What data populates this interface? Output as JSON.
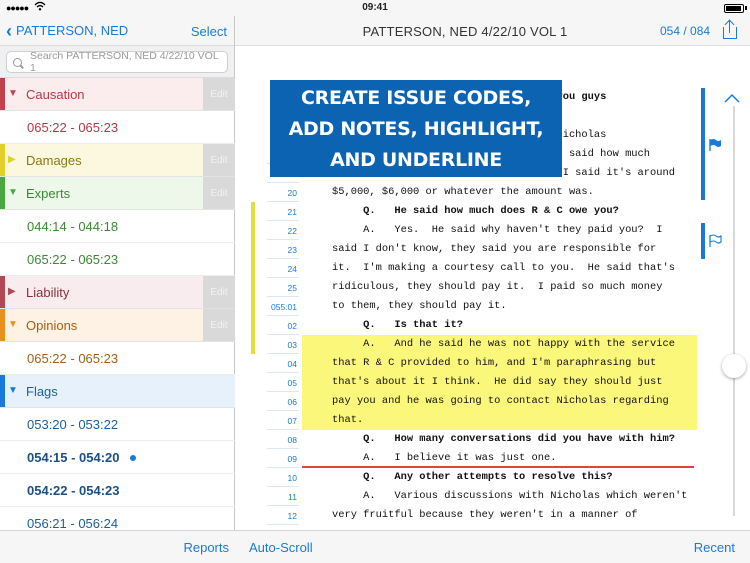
{
  "status": {
    "time": "09:41"
  },
  "left": {
    "back_label": "PATTERSON, NED",
    "select_label": "Select",
    "search_placeholder": "Search PATTERSON, NED 4/22/10 VOL 1",
    "rows": [
      {
        "kind": "category",
        "name": "Causation",
        "color": "#c0404b",
        "bg": "#fbecee",
        "edit": "Edit",
        "text_color": "#b03a45"
      },
      {
        "kind": "item",
        "text": "065:22 - 065:23",
        "color": "#b03a45"
      },
      {
        "kind": "category",
        "name": "Damages",
        "color": "#e2cf2a",
        "bg": "#fbf8df",
        "edit": "Edit",
        "text_color": "#8a7a12"
      },
      {
        "kind": "category",
        "name": "Experts",
        "color": "#4aa843",
        "bg": "#edf7ea",
        "edit": "Edit",
        "text_color": "#3a8a34"
      },
      {
        "kind": "item",
        "text": "044:14 - 044:18",
        "color": "#3a8a34"
      },
      {
        "kind": "item",
        "text": "065:22 - 065:23",
        "color": "#3a8a34"
      },
      {
        "kind": "category",
        "name": "Liability",
        "color": "#b24a56",
        "bg": "#f8ecee",
        "edit": "Edit",
        "text_color": "#8c2f3b"
      },
      {
        "kind": "category",
        "name": "Opinions",
        "color": "#e79020",
        "bg": "#fdf2e3",
        "edit": "Edit",
        "text_color": "#a65f12"
      },
      {
        "kind": "item",
        "text": "065:22 - 065:23",
        "color": "#a65f12"
      },
      {
        "kind": "category",
        "name": "Flags",
        "color": "#1a7ad9",
        "bg": "#e7f1fb",
        "edit": "",
        "text_color": "#1b5f9f"
      },
      {
        "kind": "item",
        "text": "053:20 - 053:22",
        "color": "#1b5f9f"
      },
      {
        "kind": "item",
        "text": "054:15 - 054:20",
        "color": "#1b4f86",
        "bold": true,
        "dot": true
      },
      {
        "kind": "item",
        "text": "054:22 - 054:23",
        "color": "#1b4f86",
        "bold": true
      },
      {
        "kind": "item",
        "text": "056:21 - 056:24",
        "color": "#1b5f9f"
      }
    ],
    "reports_label": "Reports"
  },
  "right": {
    "title": "PATTERSON, NED 4/22/10 VOL 1",
    "page_count": "054 / 084",
    "autoscroll_label": "Auto-Scroll",
    "recent_label": "Recent",
    "overlay_lines": [
      "CREATE ISSUE CODES,",
      "ADD NOTES, HIGHLIGHT,",
      "AND UNDERLINE"
    ],
    "lines": [
      {
        "n": "",
        "t": "                                    you guys",
        "bold": true
      },
      {
        "n": "",
        "t": ""
      },
      {
        "n": "",
        "t": "                                    Nicholas"
      },
      {
        "n": "18",
        "t": "Richards to try to collect money.  He said how much"
      },
      {
        "n": "19",
        "t": "does R & C owe you for the gadgets?  I said it's around"
      },
      {
        "n": "20",
        "t": "$5,000, $6,000 or whatever the amount was."
      },
      {
        "n": "21",
        "t": "     Q.   He said how much does R & C owe you?",
        "bold": true
      },
      {
        "n": "22",
        "t": "     A.   Yes.  He said why haven't they paid you?  I"
      },
      {
        "n": "23",
        "t": "said I don't know, they said you are responsible for"
      },
      {
        "n": "24",
        "t": "it.  I'm making a courtesy call to you.  He said that's"
      },
      {
        "n": "25",
        "t": "ridiculous, they should pay it.  I paid so much money"
      },
      {
        "n": "055:01",
        "t": "to them, they should pay it."
      },
      {
        "n": "02",
        "t": "     Q.   Is that it?",
        "bold": true
      },
      {
        "n": "03",
        "t": "     A.   And he said he was not happy with the service",
        "hl": true
      },
      {
        "n": "04",
        "t": "that R & C provided to him, and I'm paraphrasing but",
        "hl": true
      },
      {
        "n": "05",
        "t": "that's about it I think.  He did say they should just",
        "hl": true
      },
      {
        "n": "06",
        "t": "pay you and he was going to contact Nicholas regarding",
        "hl": true
      },
      {
        "n": "07",
        "t": "that.",
        "hl": true
      },
      {
        "n": "08",
        "t": "     Q.   How many conversations did you have with him?",
        "bold": true
      },
      {
        "n": "09",
        "t": "     A.   I believe it was just one.",
        "ul": true
      },
      {
        "n": "10",
        "t": "     Q.   Any other attempts to resolve this?",
        "bold": true
      },
      {
        "n": "11",
        "t": "     A.   Various discussions with Nicholas which weren't"
      },
      {
        "n": "12",
        "t": "very fruitful because they weren't in a manner of"
      }
    ]
  },
  "colors": {
    "accent": "#1a7ad9",
    "highlight": "#fbf77a",
    "underline": "#d9453f",
    "overlay": "#0b63b1"
  }
}
